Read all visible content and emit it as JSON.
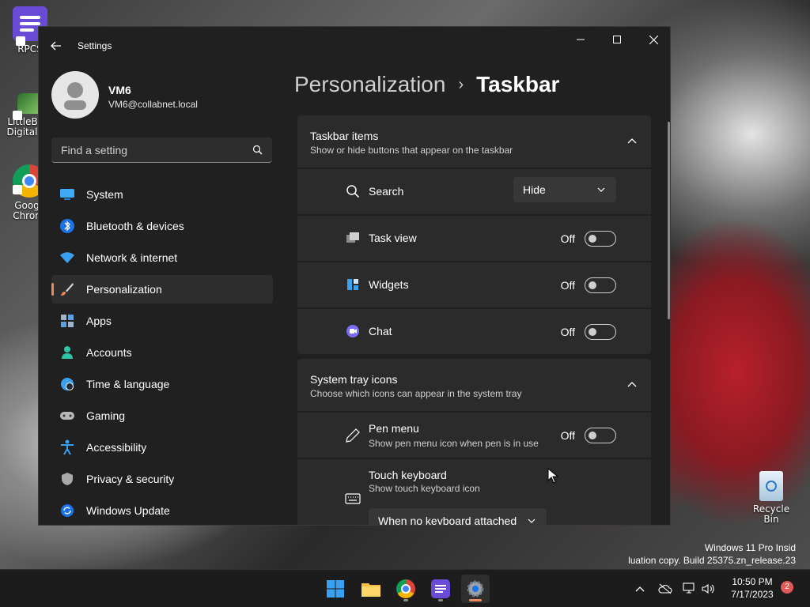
{
  "desktop": {
    "icons": [
      {
        "label": "RPCS"
      },
      {
        "label": "LittleBig Digital V"
      },
      {
        "label": "Goog Chron"
      },
      {
        "label": "Recycle Bin"
      }
    ],
    "watermark": {
      "line1": "Windows 11 Pro Insid",
      "line2": "luation copy. Build 25375.zn_release.23"
    }
  },
  "window": {
    "title": "Settings",
    "user": {
      "name": "VM6",
      "email": "VM6@collabnet.local"
    },
    "search": {
      "placeholder": "Find a setting"
    },
    "nav": [
      {
        "label": "System",
        "icon": "monitor-icon"
      },
      {
        "label": "Bluetooth & devices",
        "icon": "bluetooth-icon"
      },
      {
        "label": "Network & internet",
        "icon": "wifi-icon"
      },
      {
        "label": "Personalization",
        "icon": "brush-icon",
        "active": true
      },
      {
        "label": "Apps",
        "icon": "apps-icon"
      },
      {
        "label": "Accounts",
        "icon": "person-icon"
      },
      {
        "label": "Time & language",
        "icon": "globe-clock-icon"
      },
      {
        "label": "Gaming",
        "icon": "gamepad-icon"
      },
      {
        "label": "Accessibility",
        "icon": "accessibility-icon"
      },
      {
        "label": "Privacy & security",
        "icon": "shield-icon"
      },
      {
        "label": "Windows Update",
        "icon": "update-icon"
      }
    ],
    "breadcrumb": {
      "parent": "Personalization",
      "separator": "›",
      "current": "Taskbar"
    },
    "groups": {
      "taskbar_items": {
        "title": "Taskbar items",
        "subtitle": "Show or hide buttons that appear on the taskbar",
        "rows": {
          "search": {
            "label": "Search",
            "value": "Hide"
          },
          "taskview": {
            "label": "Task view",
            "state": "Off"
          },
          "widgets": {
            "label": "Widgets",
            "state": "Off"
          },
          "chat": {
            "label": "Chat",
            "state": "Off"
          }
        }
      },
      "system_tray": {
        "title": "System tray icons",
        "subtitle": "Choose which icons can appear in the system tray",
        "rows": {
          "pen": {
            "label": "Pen menu",
            "sub": "Show pen menu icon when pen is in use",
            "state": "Off"
          },
          "touch": {
            "label": "Touch keyboard",
            "sub": "Show touch keyboard icon",
            "value": "When no keyboard attached"
          }
        }
      }
    }
  },
  "taskbar": {
    "apps": [
      "start-icon",
      "file-explorer-icon",
      "chrome-icon",
      "notepad-app-icon",
      "settings-icon"
    ],
    "clock": {
      "time": "10:50 PM",
      "date": "7/17/2023"
    },
    "notification_count": "2"
  },
  "colors": {
    "accent": "#f08a5d",
    "window_bg": "#202020",
    "card_bg": "#2b2b2b"
  }
}
